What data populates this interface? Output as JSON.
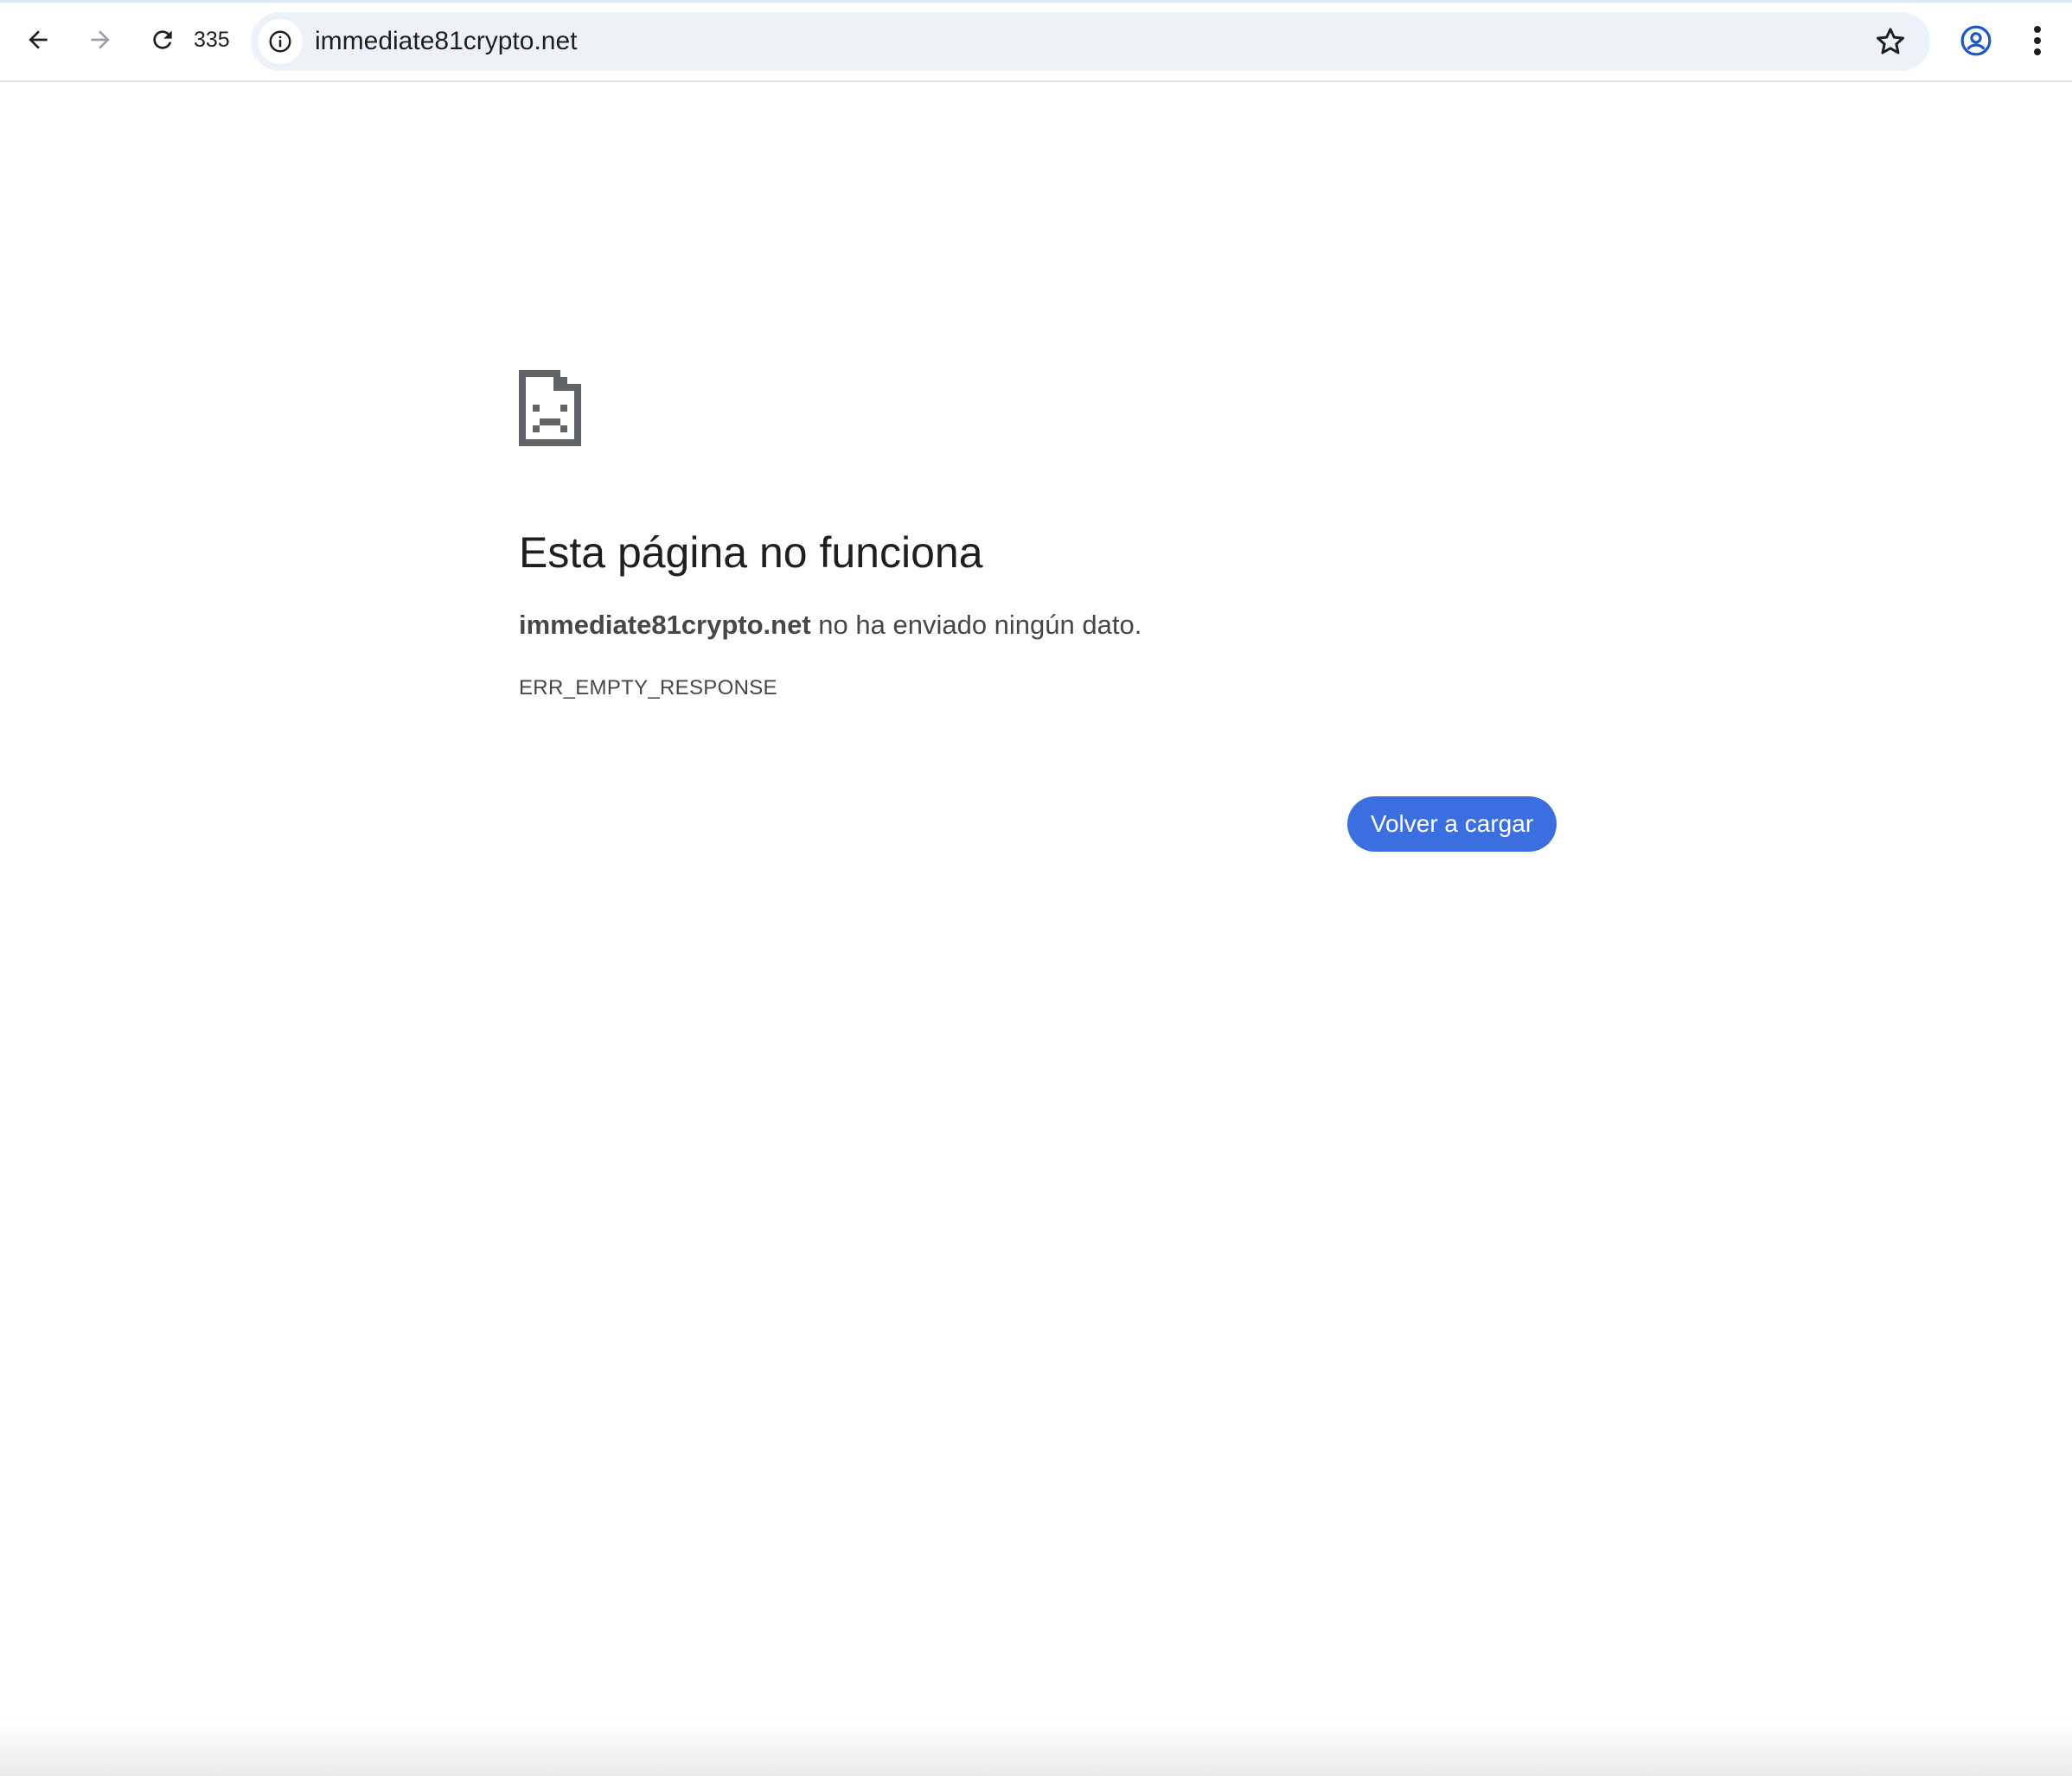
{
  "browser": {
    "reload_count": "335",
    "url": "immediate81crypto.net"
  },
  "error": {
    "title": "Esta página no funciona",
    "host": "immediate81crypto.net",
    "message": " no ha enviado ningún dato.",
    "code": "ERR_EMPTY_RESPONSE",
    "reload_label": "Volver a cargar"
  },
  "colors": {
    "omnibox_bg": "#edf2fa",
    "button_bg": "#3b6fe0",
    "profile_icon": "#1a56c4",
    "text_primary": "#1f1f1f",
    "text_secondary": "#474747"
  },
  "icons": {
    "back": "back-arrow-icon",
    "forward": "forward-arrow-icon",
    "reload": "reload-icon",
    "site_info": "info-icon",
    "bookmark": "star-icon",
    "profile": "profile-icon",
    "menu": "kebab-menu-icon",
    "error": "sad-page-icon"
  }
}
